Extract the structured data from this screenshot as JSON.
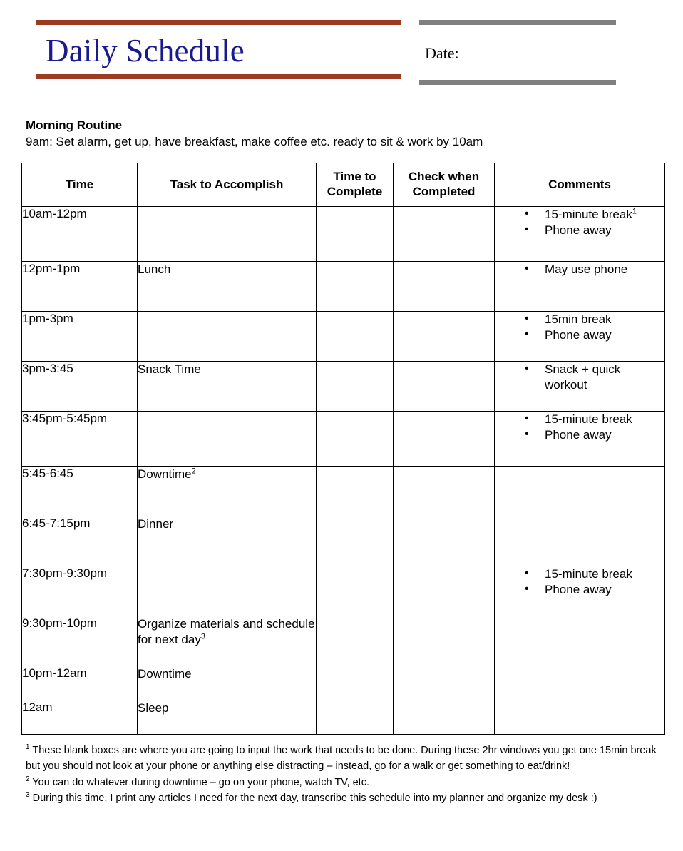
{
  "header": {
    "title": "Daily Schedule",
    "date_label": "Date:",
    "rule_red_color": "#9c3a22",
    "rule_gray_color": "#7f7f7f",
    "title_color": "#1a1a8c"
  },
  "morning": {
    "heading": "Morning Routine",
    "description": "9am: Set alarm, get up, have breakfast, make coffee etc. ready to sit & work by 10am"
  },
  "table": {
    "columns": [
      "Time",
      "Task to Accomplish",
      "Time to Complete",
      "Check when Completed",
      "Comments"
    ],
    "columns_wrapped": [
      [
        "Time"
      ],
      [
        "Task to Accomplish"
      ],
      [
        "Time to",
        "Complete"
      ],
      [
        "Check when",
        "Completed"
      ],
      [
        "Comments"
      ]
    ],
    "rows": [
      {
        "time": "10am-12pm",
        "task": "",
        "task_sup": "",
        "time_to_complete": "",
        "check_when_completed": "",
        "comments": [
          "15-minute break",
          "Phone away"
        ],
        "comments_sup": [
          "1",
          ""
        ]
      },
      {
        "time": "12pm-1pm",
        "task": "Lunch",
        "task_sup": "",
        "time_to_complete": "",
        "check_when_completed": "",
        "comments": [
          "May use phone"
        ],
        "comments_sup": [
          ""
        ]
      },
      {
        "time": "1pm-3pm",
        "task": "",
        "task_sup": "",
        "time_to_complete": "",
        "check_when_completed": "",
        "comments": [
          "15min break",
          "Phone away"
        ],
        "comments_sup": [
          "",
          ""
        ]
      },
      {
        "time": "3pm-3:45",
        "task": "Snack Time",
        "task_sup": "",
        "time_to_complete": "",
        "check_when_completed": "",
        "comments": [
          "Snack + quick workout"
        ],
        "comments_sup": [
          ""
        ]
      },
      {
        "time": "3:45pm-5:45pm",
        "task": "",
        "task_sup": "",
        "time_to_complete": "",
        "check_when_completed": "",
        "comments": [
          "15-minute break",
          "Phone away"
        ],
        "comments_sup": [
          "",
          ""
        ]
      },
      {
        "time": "5:45-6:45",
        "task": "Downtime",
        "task_sup": "2",
        "time_to_complete": "",
        "check_when_completed": "",
        "comments": [],
        "comments_sup": []
      },
      {
        "time": "6:45-7:15pm",
        "task": "Dinner",
        "task_sup": "",
        "time_to_complete": "",
        "check_when_completed": "",
        "comments": [],
        "comments_sup": []
      },
      {
        "time": "7:30pm-9:30pm",
        "task": "",
        "task_sup": "",
        "time_to_complete": "",
        "check_when_completed": "",
        "comments": [
          "15-minute break",
          "Phone away"
        ],
        "comments_sup": [
          "",
          ""
        ]
      },
      {
        "time": "9:30pm-10pm",
        "task": "Organize materials and schedule for next day",
        "task_sup": "3",
        "time_to_complete": "",
        "check_when_completed": "",
        "comments": [],
        "comments_sup": []
      },
      {
        "time": "10pm-12am",
        "task": "Downtime",
        "task_sup": "",
        "time_to_complete": "",
        "check_when_completed": "",
        "comments": [],
        "comments_sup": []
      },
      {
        "time": "12am",
        "task": "Sleep",
        "task_sup": "",
        "time_to_complete": "",
        "check_when_completed": "",
        "comments": [],
        "comments_sup": []
      }
    ]
  },
  "footnotes": [
    {
      "marker": "1",
      "text": "These blank boxes are where you are going to input the work that needs to be done. During these 2hr windows you get one 15min break but you should not look at your phone or anything else distracting – instead, go for a walk or get something to eat/drink!"
    },
    {
      "marker": "2",
      "text": "You can do whatever during downtime – go on your phone, watch TV, etc."
    },
    {
      "marker": "3",
      "text": "During this time, I print any articles I need for the next day, transcribe this schedule into my planner and organize my desk :)"
    }
  ]
}
